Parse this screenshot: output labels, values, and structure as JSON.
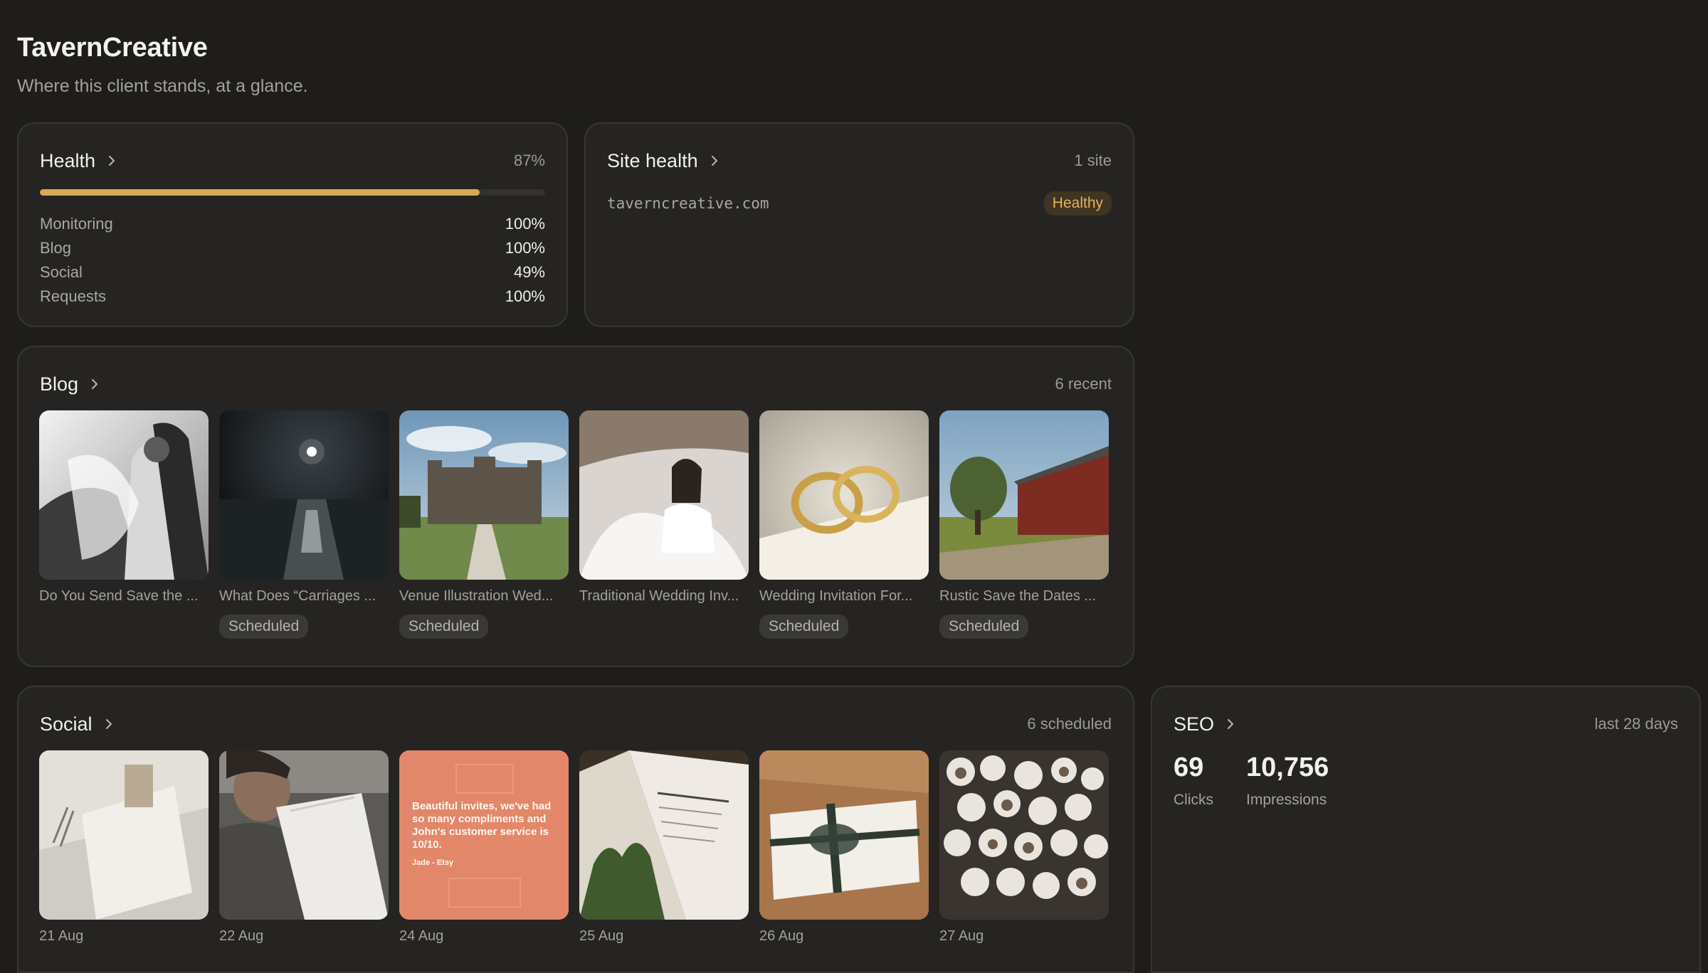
{
  "header": {
    "title": "TavernCreative",
    "subtitle": "Where this client stands, at a glance."
  },
  "health": {
    "title": "Health",
    "percent_label": "87%",
    "progress": 0.87,
    "rows": [
      {
        "label": "Monitoring",
        "value": "100%"
      },
      {
        "label": "Blog",
        "value": "100%"
      },
      {
        "label": "Social",
        "value": "49%"
      },
      {
        "label": "Requests",
        "value": "100%"
      }
    ]
  },
  "site_health": {
    "title": "Site health",
    "meta": "1 site",
    "domain": "taverncreative.com",
    "status": "Healthy"
  },
  "blog": {
    "title": "Blog",
    "meta": "6 recent",
    "posts": [
      {
        "caption": "Do You Send Save the ...",
        "status": "",
        "image": "bw-couple-photo"
      },
      {
        "caption": "What Does “Carriages ...",
        "status": "Scheduled",
        "image": "moon-over-sea-photo"
      },
      {
        "caption": "Venue Illustration Wed...",
        "status": "Scheduled",
        "image": "manor-house-photo"
      },
      {
        "caption": "Traditional Wedding Inv...",
        "status": "",
        "image": "bride-in-car-photo"
      },
      {
        "caption": "Wedding Invitation For...",
        "status": "Scheduled",
        "image": "gold-rings-photo"
      },
      {
        "caption": "Rustic Save the Dates ...",
        "status": "Scheduled",
        "image": "red-barn-photo"
      }
    ]
  },
  "social": {
    "title": "Social",
    "meta": "6 scheduled",
    "posts": [
      {
        "date": "21 Aug",
        "image": "place-card-photo"
      },
      {
        "date": "22 Aug",
        "image": "man-with-invite-photo"
      },
      {
        "date": "24 Aug",
        "image": "testimonial-graphic",
        "quote": "Beautiful invites, we've had so many compliments and John's customer service is 10/10.",
        "quote_author": "Jade - Etsy"
      },
      {
        "date": "25 Aug",
        "image": "invitation-booklet-photo"
      },
      {
        "date": "26 Aug",
        "image": "ribbon-envelope-photo"
      },
      {
        "date": "27 Aug",
        "image": "confetti-cones-photo"
      }
    ]
  },
  "seo": {
    "title": "SEO",
    "meta": "last 28 days",
    "clicks_value": "69",
    "clicks_label": "Clicks",
    "impressions_value": "10,756",
    "impressions_label": "Impressions"
  },
  "colors": {
    "background": "#1e1d1b",
    "card": "#252422",
    "accent": "#d9aa55",
    "healthy_badge_text": "#e3b35c"
  }
}
